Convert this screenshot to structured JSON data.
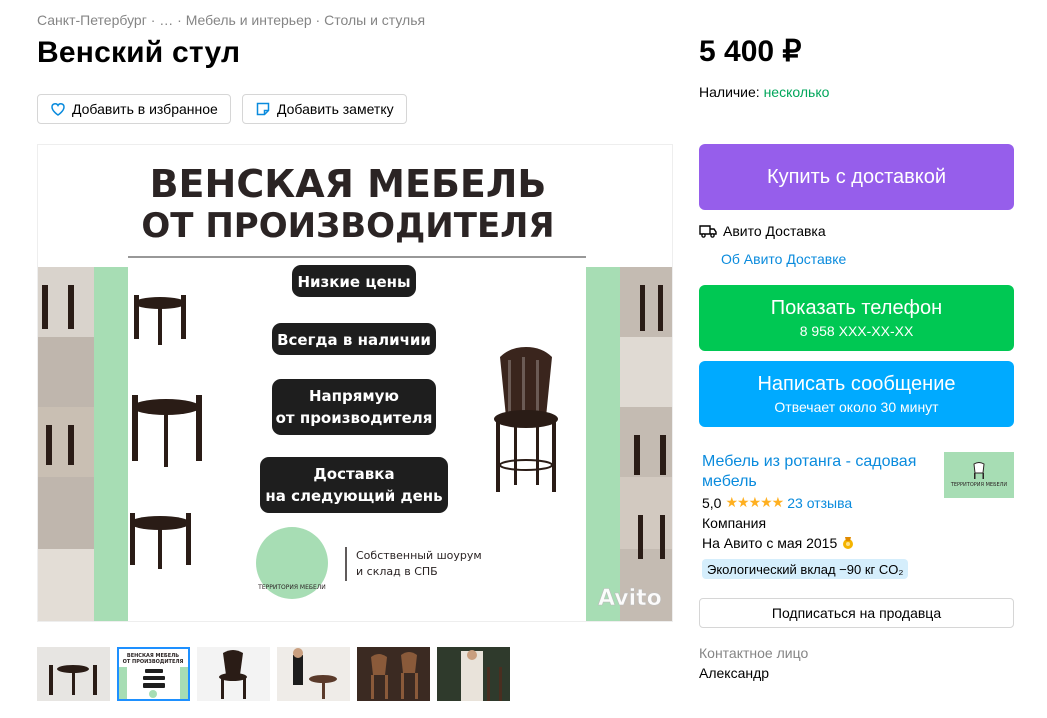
{
  "breadcrumb": [
    "Санкт-Петербург",
    "…",
    "Мебель и интерьер",
    "Столы и стулья"
  ],
  "title": "Венский стул",
  "actions": {
    "favorite": "Добавить в избранное",
    "note": "Добавить заметку"
  },
  "photo": {
    "headline1": "ВЕНСКАЯ МЕБЕЛЬ",
    "headline2": "ОТ ПРОИЗВОДИТЕЛЯ",
    "badges": [
      "Низкие цены",
      "Всегда в наличии",
      "Напрямую",
      "от производителя",
      "Доставка",
      "на следующий день"
    ],
    "logo_text": "ТЕРРИТОРИЯ МЕБЕЛИ",
    "showroom1": "Собственный шоурум",
    "showroom2": "и склад в СПБ",
    "watermark": "Avito"
  },
  "thumb_mini": {
    "line1": "ВЕНСКАЯ МЕБЕЛЬ",
    "line2": "ОТ ПРОИЗВОДИТЕЛЯ"
  },
  "price": "5 400 ₽",
  "availability": {
    "label": "Наличие:",
    "value": "несколько"
  },
  "buy_button": "Купить с доставкой",
  "delivery": {
    "label": "Авито Доставка",
    "link": "Об Авито Доставке"
  },
  "phone_button": {
    "label": "Показать телефон",
    "number": "8 958 XXX-XX-XX"
  },
  "message_button": {
    "label": "Написать сообщение",
    "sub": "Отвечает около 30 минут"
  },
  "seller": {
    "name": "Мебель из ротанга - садовая мебель",
    "rating": "5,0",
    "stars": "★★★★★",
    "reviews": "23 отзыва",
    "type": "Компания",
    "since": "На Авито с мая 2015",
    "eco": "Экологический вклад −90 кг CO₂",
    "logo_text": "ТЕРРИТОРИЯ МЕБЕЛИ"
  },
  "subscribe": "Подписаться на продавца",
  "contact": {
    "label": "Контактное лицо",
    "name": "Александр"
  },
  "colors": {
    "buy": "#965eeb",
    "phone": "#00c853",
    "message": "#00aaff",
    "link": "#0a8bdd",
    "available": "#02a65b"
  }
}
